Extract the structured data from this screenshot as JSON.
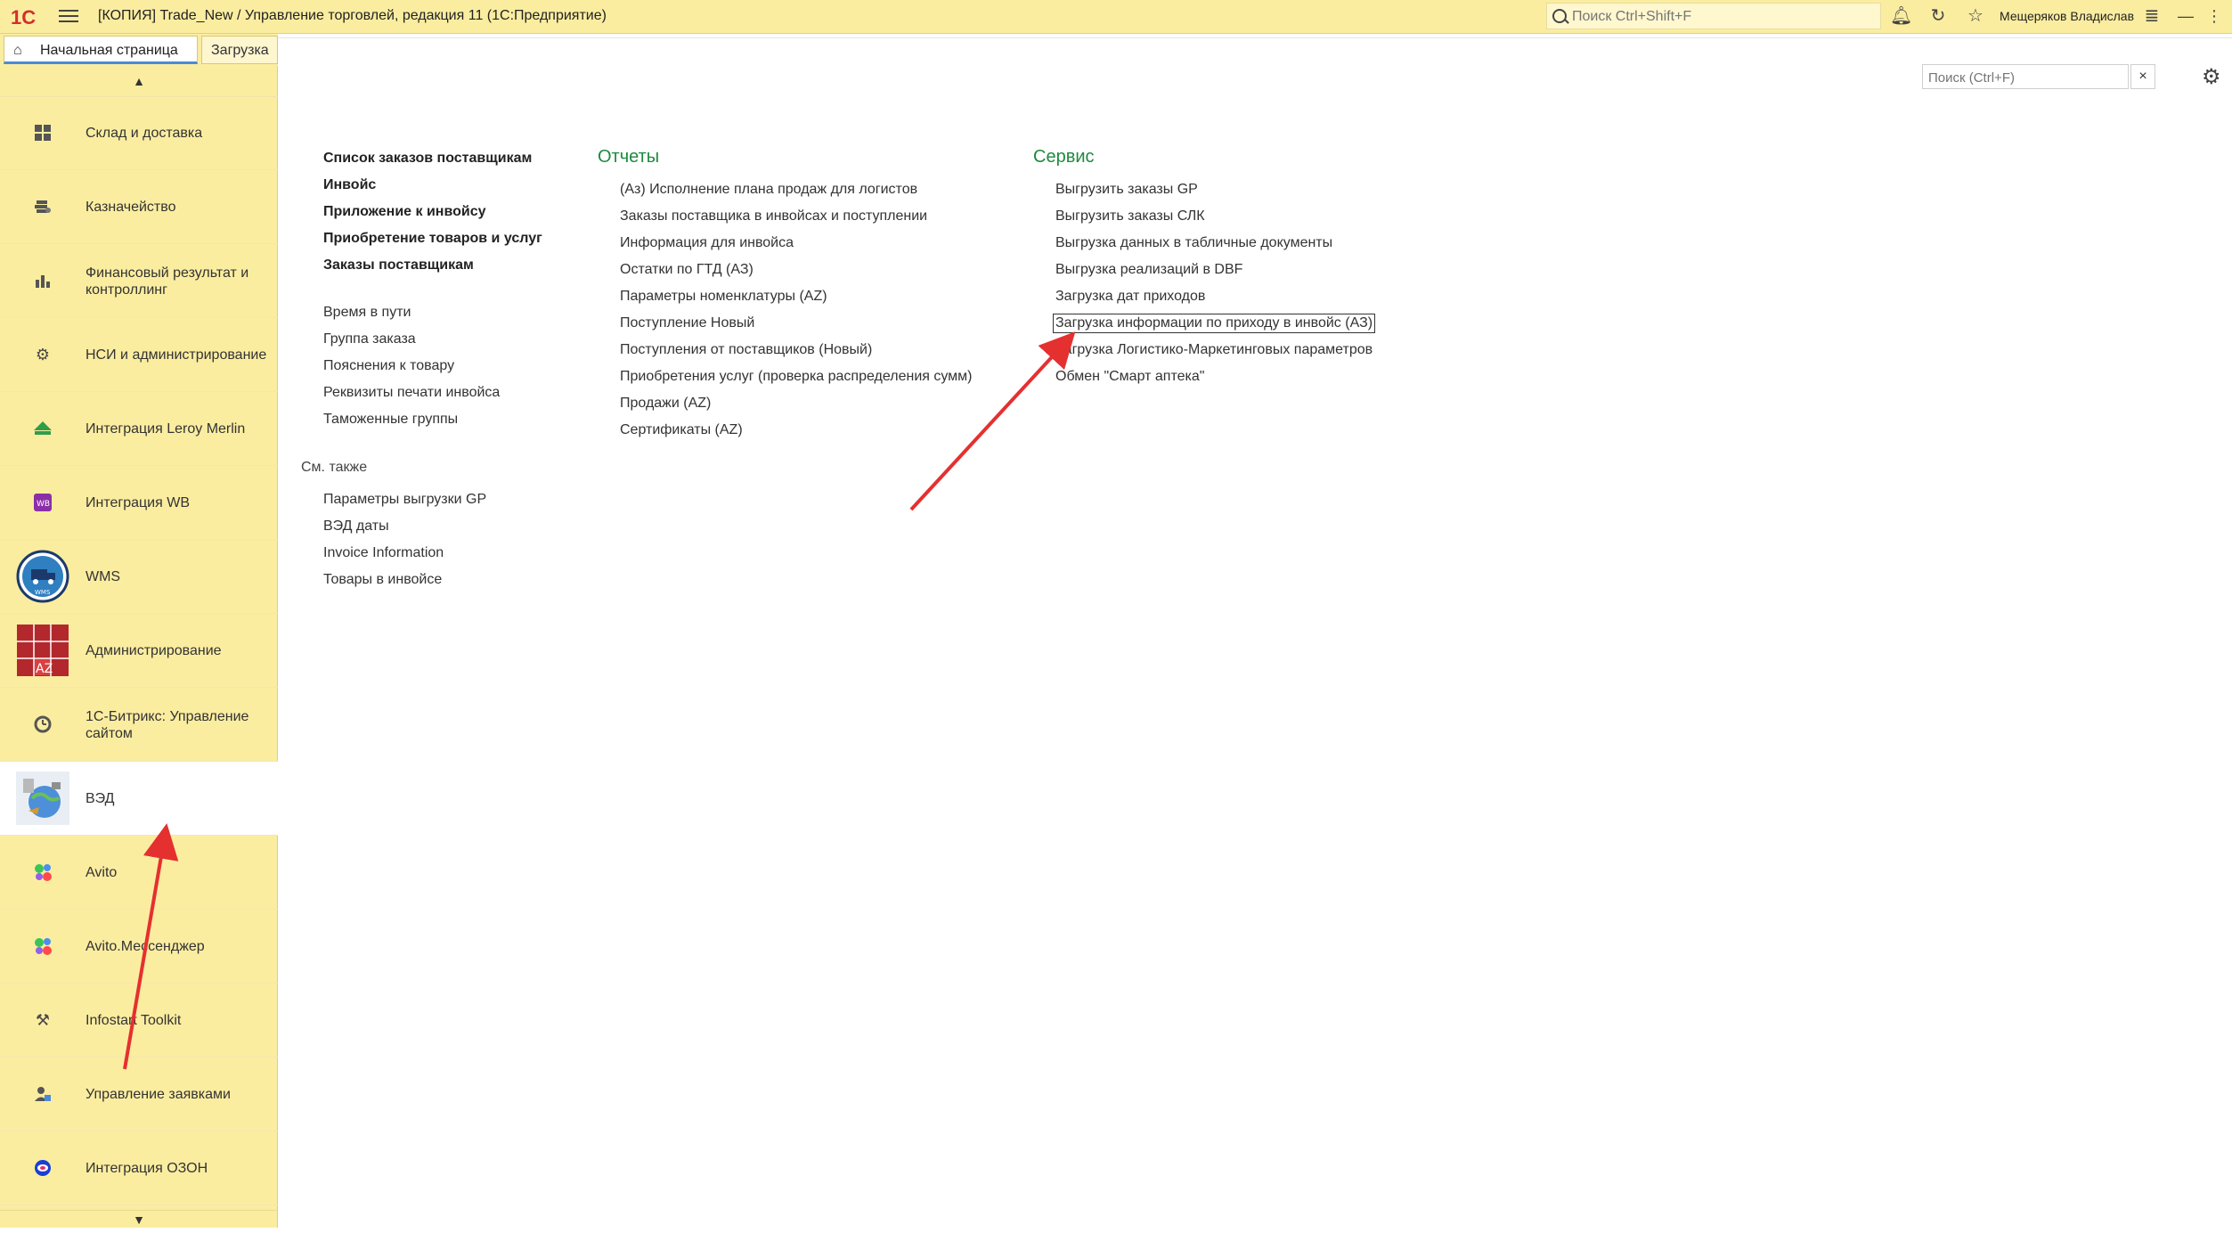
{
  "titlebar": {
    "logo": "1С",
    "title": "[КОПИЯ] Trade_New / Управление торговлей, редакция 11  (1С:Предприятие)",
    "search_placeholder": "Поиск Ctrl+Shift+F",
    "user": "Мещеряков Владислав"
  },
  "tabs": {
    "home": "Начальная страница",
    "load": "Загрузка"
  },
  "sidebar": {
    "items": [
      {
        "label": "Склад и доставка",
        "icon": "warehouse-icon"
      },
      {
        "label": "Казначейство",
        "icon": "treasury-icon"
      },
      {
        "label": "Финансовый результат и контроллинг",
        "icon": "chart-icon"
      },
      {
        "label": "НСИ и администрирование",
        "icon": "gear-icon"
      },
      {
        "label": "Интеграция Leroy Merlin",
        "icon": "leroy-merlin-icon"
      },
      {
        "label": "Интеграция WB",
        "icon": "wb-icon"
      },
      {
        "label": "WMS",
        "icon": "wms-icon"
      },
      {
        "label": "Администрирование",
        "icon": "az-icon"
      },
      {
        "label": "1С-Битрикс: Управление сайтом",
        "icon": "bitrix-icon"
      },
      {
        "label": "ВЭД",
        "icon": "globe-icon"
      },
      {
        "label": "Avito",
        "icon": "avito-icon"
      },
      {
        "label": "Avito.Мессенджер",
        "icon": "avito-messenger-icon"
      },
      {
        "label": "Infostart Toolkit",
        "icon": "tools-icon"
      },
      {
        "label": "Управление заявками",
        "icon": "requests-icon"
      },
      {
        "label": "Интеграция ОЗОН",
        "icon": "ozon-icon"
      }
    ],
    "active_index": 9
  },
  "content": {
    "search_placeholder": "Поиск (Ctrl+F)",
    "clear": "×",
    "col1": {
      "bold_items": [
        "Список заказов поставщикам",
        "Инвойс",
        "Приложение к инвойсу",
        "Приобретение товаров и услуг",
        "Заказы поставщикам"
      ],
      "items": [
        "Время в пути",
        "Группа заказа",
        "Пояснения к товару",
        "Реквизиты печати инвойса",
        "Таможенные группы"
      ],
      "see_also_head": "См. также",
      "see_also": [
        "Параметры выгрузки GP",
        "ВЭД даты",
        "Invoice Information",
        "Товары в инвойсе"
      ]
    },
    "col2": {
      "head": "Отчеты",
      "items": [
        "(Аз) Исполнение плана продаж для логистов",
        "Заказы поставщика в инвойсах и поступлении",
        "Информация для инвойса",
        "Остатки по ГТД (АЗ)",
        "Параметры номенклатуры (AZ)",
        "Поступление Новый",
        "Поступления от поставщиков (Новый)",
        "Приобретения услуг (проверка распределения сумм)",
        "Продажи (AZ)",
        "Сертификаты (AZ)"
      ]
    },
    "col3": {
      "head": "Сервис",
      "items": [
        "Выгрузить заказы GP",
        "Выгрузить заказы СЛК",
        "Выгрузка данных в табличные документы",
        "Выгрузка реализаций в DBF",
        "Загрузка дат приходов",
        "Загрузка информации по приходу в инвойс (АЗ)",
        "Загрузка Логистико-Маркетинговых параметров",
        "Обмен \"Смарт аптека\""
      ],
      "highlight_index": 5
    }
  },
  "colors": {
    "sidebar_bg": "#fbeda0",
    "section_head": "#1e8a3f",
    "arrow": "#e53030",
    "logo": "#d32f2f"
  }
}
